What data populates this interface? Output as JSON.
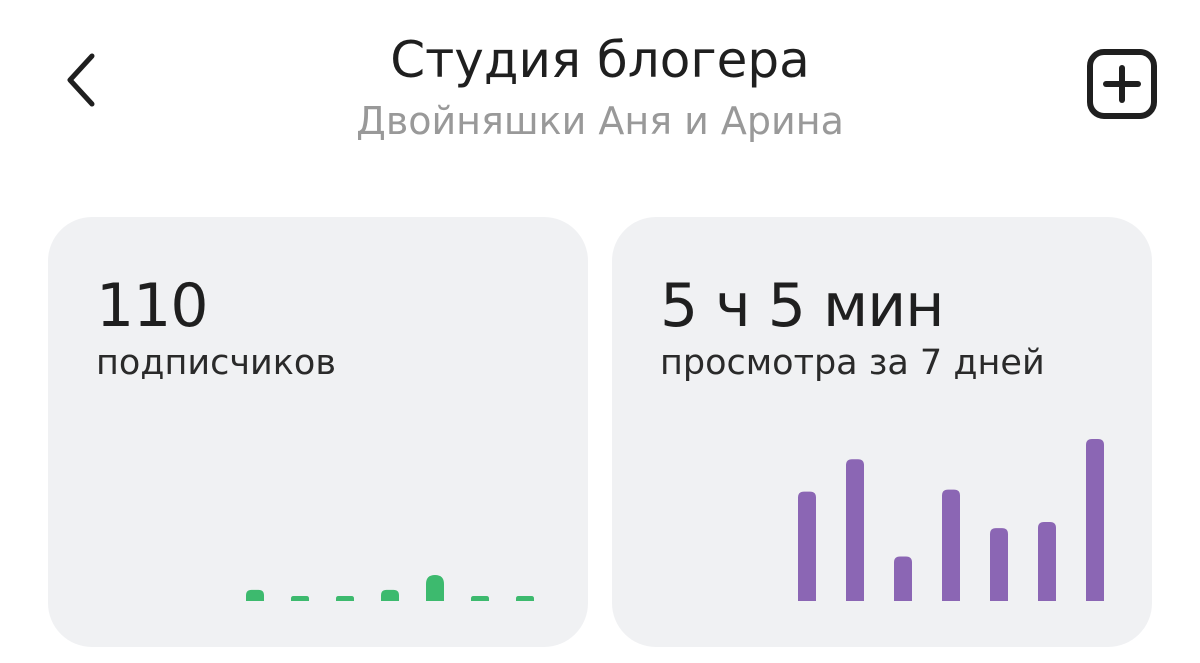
{
  "header": {
    "title": "Студия блогера",
    "subtitle": "Двойняшки Аня и Арина",
    "back_icon": "chevron-left-icon",
    "add_icon": "plus-square-icon"
  },
  "cards": {
    "subscribers": {
      "value": "110",
      "label": "подписчиков",
      "color": "#3dba6e"
    },
    "views": {
      "value": "5 ч 5 мин",
      "label": "просмотра за 7 дней",
      "color": "#8b66b4"
    }
  },
  "chart_data": [
    {
      "type": "bar",
      "values": [
        3,
        1,
        1,
        3,
        7,
        1,
        1
      ],
      "ylim": [
        0,
        25
      ],
      "grid": false
    },
    {
      "type": "bar",
      "values": [
        54,
        70,
        22,
        55,
        36,
        39,
        80
      ],
      "ylim": [
        0,
        80
      ],
      "grid": false
    }
  ]
}
